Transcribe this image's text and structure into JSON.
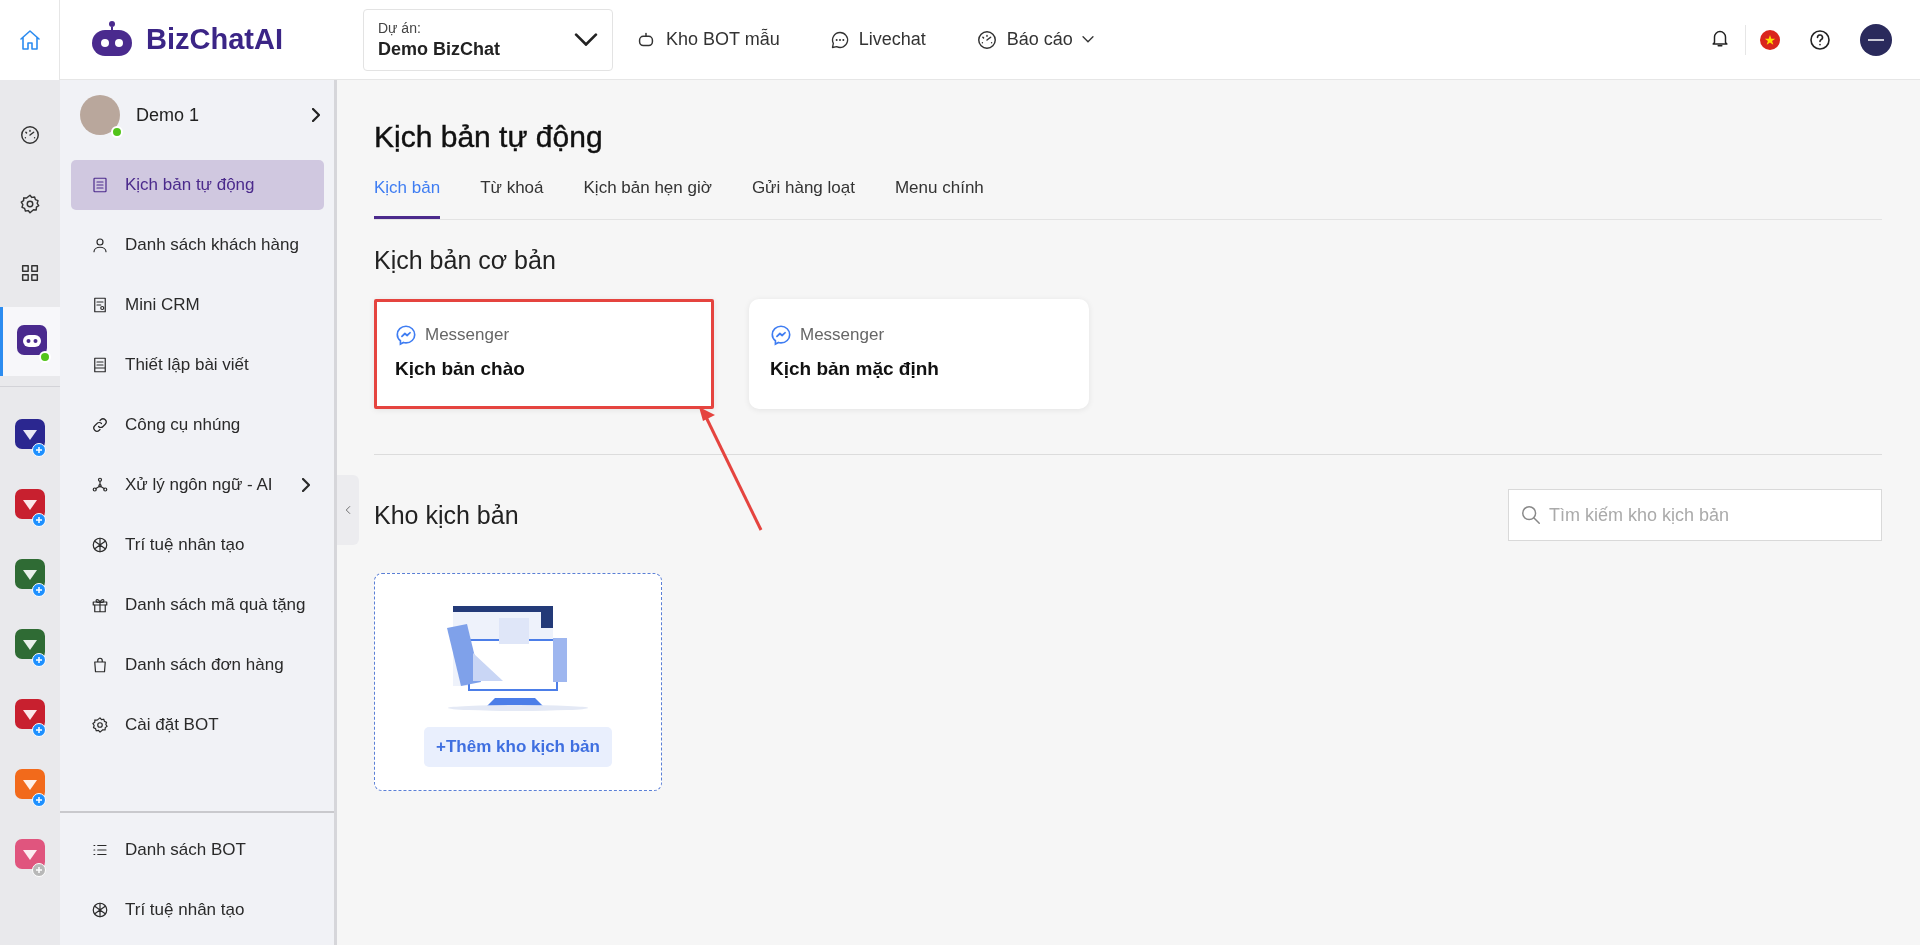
{
  "topbar": {
    "logo": "BizChatAI",
    "project": {
      "label": "Dự án:",
      "value": "Demo BizChat"
    },
    "nav": [
      {
        "label": "Kho BOT mẫu",
        "dropdown": false
      },
      {
        "label": "Livechat",
        "dropdown": false
      },
      {
        "label": "Báo cáo",
        "dropdown": true
      }
    ]
  },
  "rail": {
    "nav": [
      {
        "selected": false
      },
      {
        "selected": false
      },
      {
        "selected": false
      },
      {
        "selected": true
      }
    ],
    "apps": [
      {
        "color": "#2b2790",
        "disabled": false
      },
      {
        "color": "#c8202f",
        "disabled": false
      },
      {
        "color": "#2f6b34",
        "disabled": false
      },
      {
        "color": "#2f6b34",
        "disabled": false
      },
      {
        "color": "#c8202f",
        "disabled": false
      },
      {
        "color": "#f26a1b",
        "disabled": false
      },
      {
        "color": "#e0557e",
        "disabled": true
      }
    ]
  },
  "sidebar": {
    "account": {
      "name": "Demo 1",
      "online": true
    },
    "items": [
      {
        "label": "Kịch bản tự động",
        "selected": true,
        "submenu": false
      },
      {
        "label": "Danh sách khách hàng",
        "selected": false,
        "submenu": false
      },
      {
        "label": "Mini CRM",
        "selected": false,
        "submenu": false
      },
      {
        "label": "Thiết lập bài viết",
        "selected": false,
        "submenu": false
      },
      {
        "label": "Công cụ nhúng",
        "selected": false,
        "submenu": false
      },
      {
        "label": "Xử lý ngôn ngữ - AI",
        "selected": false,
        "submenu": true
      },
      {
        "label": "Trí tuệ nhân tạo",
        "selected": false,
        "submenu": false
      },
      {
        "label": "Danh sách mã quà tặng",
        "selected": false,
        "submenu": false
      },
      {
        "label": "Danh sách đơn hàng",
        "selected": false,
        "submenu": false
      },
      {
        "label": "Cài đặt BOT",
        "selected": false,
        "submenu": false
      }
    ],
    "bottom_items": [
      {
        "label": "Danh sách BOT",
        "selected": false
      },
      {
        "label": "Trí tuệ nhân tạo",
        "selected": false
      }
    ]
  },
  "main": {
    "title": "Kịch bản tự động",
    "tabs": [
      {
        "label": "Kịch bản",
        "selected": true
      },
      {
        "label": "Từ khoá",
        "selected": false
      },
      {
        "label": "Kịch bản hẹn giờ",
        "selected": false
      },
      {
        "label": "Gửi hàng loạt",
        "selected": false
      },
      {
        "label": "Menu chính",
        "selected": false
      }
    ],
    "basic_title": "Kịch bản cơ bản",
    "cards": [
      {
        "channel": "Messenger",
        "title": "Kịch bản chào",
        "highlighted": true
      },
      {
        "channel": "Messenger",
        "title": "Kịch bản mặc định",
        "highlighted": false
      }
    ],
    "library_title": "Kho kịch bản",
    "search": {
      "placeholder": "Tìm kiếm kho kịch bản"
    },
    "add_button": "+Thêm kho kịch bản"
  }
}
